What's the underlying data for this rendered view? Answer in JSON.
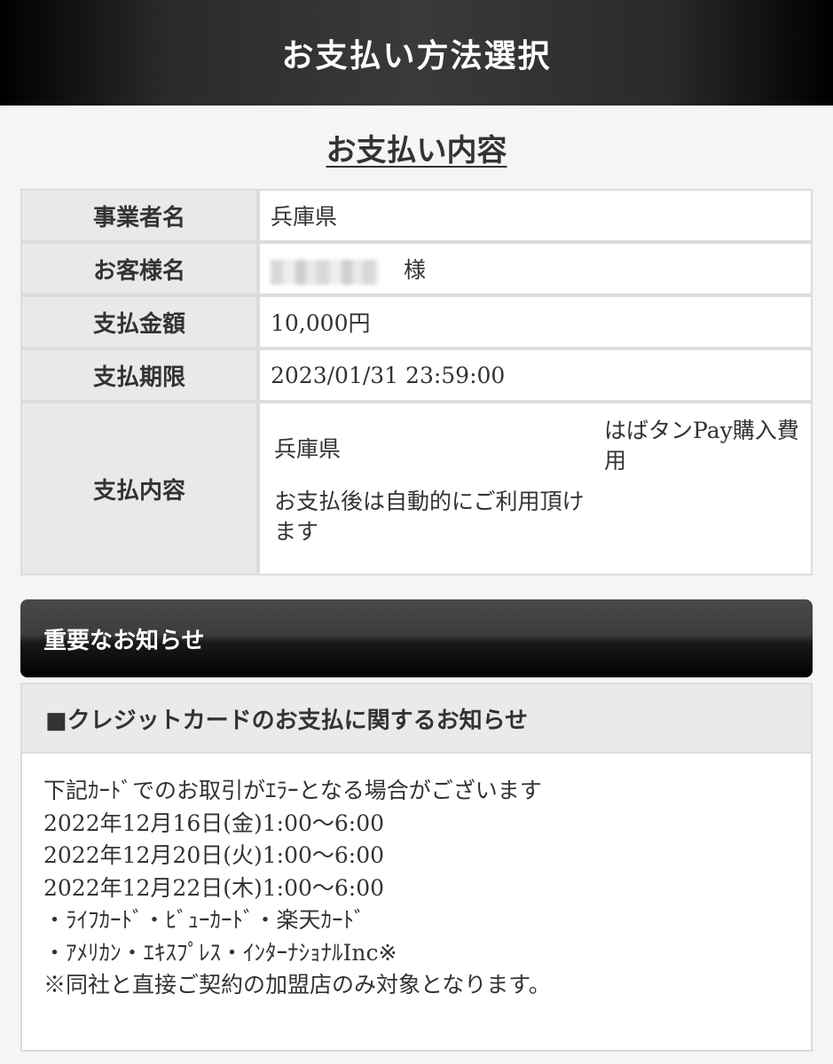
{
  "header": {
    "title": "お支払い方法選択"
  },
  "section_title": "お支払い内容",
  "details": {
    "business_label": "事業者名",
    "business_value": "兵庫県",
    "customer_label": "お客様名",
    "customer_suffix": "様",
    "amount_label": "支払金額",
    "amount_value": "10,000円",
    "deadline_label": "支払期限",
    "deadline_value": "2023/01/31 23:59:00",
    "content_label": "支払内容",
    "content_name": "兵庫県",
    "content_note": "お支払後は自動的にご利用頂けます",
    "content_item": "はばタンPay購入費用"
  },
  "notice": {
    "header": "重要なお知らせ",
    "subheader": "■クレジットカードのお支払に関するお知らせ",
    "lines": [
      "下記ｶｰﾄﾞでのお取引がｴﾗｰとなる場合がございます",
      "2022年12月16日(金)1:00～6:00",
      "2022年12月20日(火)1:00～6:00",
      "2022年12月22日(木)1:00～6:00",
      "・ﾗｲﾌｶｰﾄﾞ・ﾋﾞｭｰｶｰﾄﾞ・楽天ｶｰﾄﾞ",
      "・ｱﾒﾘｶﾝ・ｴｷｽﾌﾟﾚｽ・ｲﾝﾀｰﾅｼｮﾅﾙInc※",
      "※同社と直接ご契約の加盟店のみ対象となります。"
    ]
  }
}
